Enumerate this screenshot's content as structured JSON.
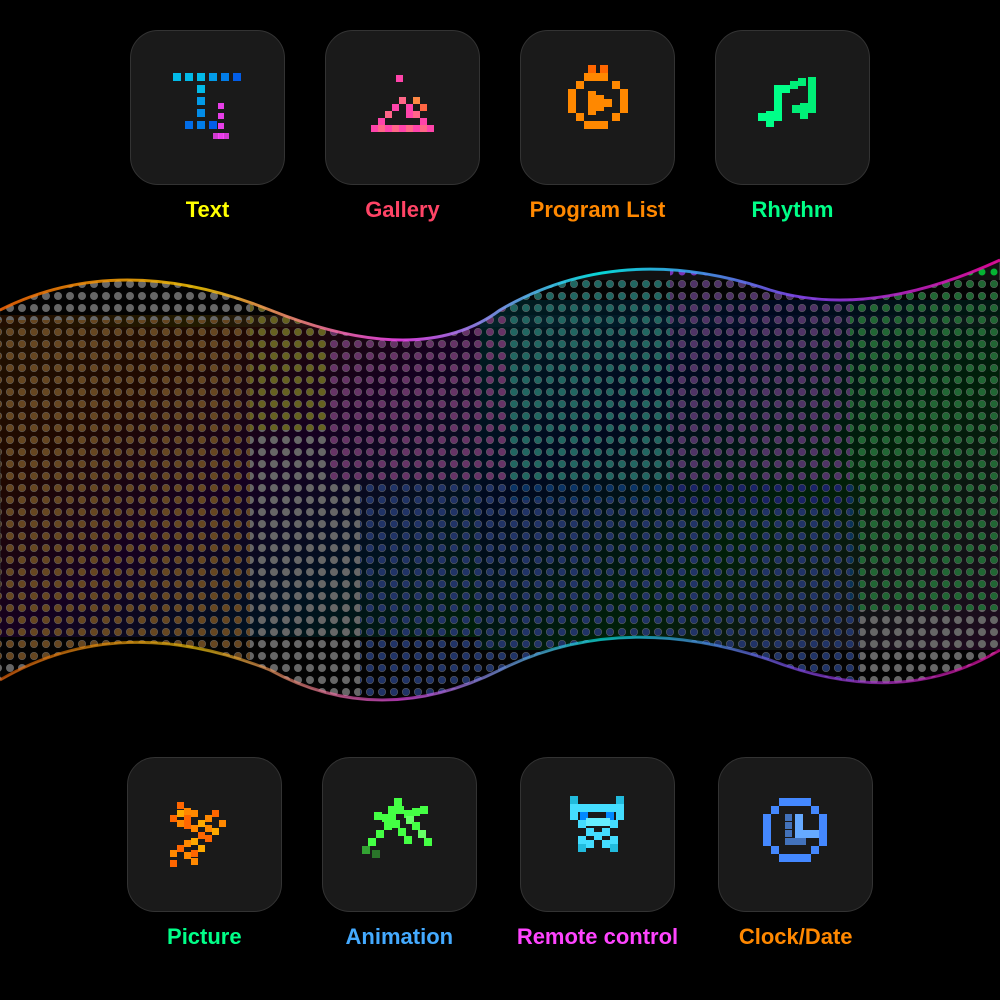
{
  "top_icons": [
    {
      "id": "text",
      "label": "Text",
      "color": "#ffff00"
    },
    {
      "id": "gallery",
      "label": "Gallery",
      "color": "#ff4466"
    },
    {
      "id": "program",
      "label": "Program List",
      "color": "#ff8800"
    },
    {
      "id": "rhythm",
      "label": "Rhythm",
      "color": "#00ff88"
    }
  ],
  "bottom_icons": [
    {
      "id": "picture",
      "label": "Picture",
      "color": "#00ff88"
    },
    {
      "id": "animation",
      "label": "Animation",
      "color": "#44aaff"
    },
    {
      "id": "remote",
      "label": "Remote control",
      "color": "#ff44ff"
    },
    {
      "id": "clock",
      "label": "Clock/Date",
      "color": "#ff8800"
    }
  ]
}
